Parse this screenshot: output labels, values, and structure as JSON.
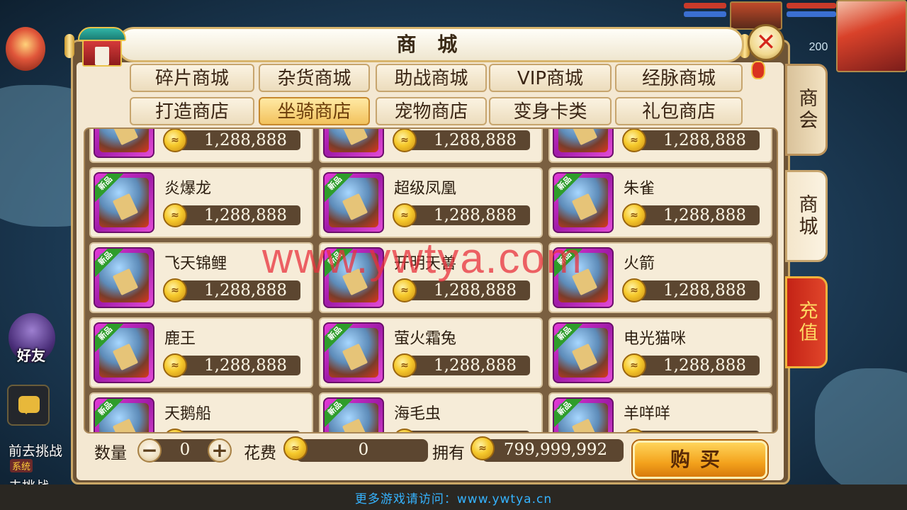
{
  "hud": {
    "hp_value": "200",
    "friend_label": "好友",
    "task_line1": "前去挑战",
    "task_tag": "系统",
    "task_line2": "去挑战"
  },
  "shop": {
    "title": "商 城",
    "close_glyph": "✕",
    "tabs_row1": [
      "碎片商城",
      "杂货商城",
      "助战商城",
      "VIP商城",
      "经脉商城"
    ],
    "tabs_row2": [
      "打造商店",
      "坐骑商店",
      "宠物商店",
      "变身卡类",
      "礼包商店"
    ],
    "active_tab": "坐骑商店",
    "new_tag": "新品",
    "coin_glyph": "≈",
    "items": [
      {
        "name": "",
        "price": "1,288,888"
      },
      {
        "name": "",
        "price": "1,288,888"
      },
      {
        "name": "",
        "price": "1,288,888"
      },
      {
        "name": "炎爆龙",
        "price": "1,288,888"
      },
      {
        "name": "超级凤凰",
        "price": "1,288,888"
      },
      {
        "name": "朱雀",
        "price": "1,288,888"
      },
      {
        "name": "飞天锦鲤",
        "price": "1,288,888"
      },
      {
        "name": "开明天兽",
        "price": "1,288,888"
      },
      {
        "name": "火箭",
        "price": "1,288,888"
      },
      {
        "name": "鹿王",
        "price": "1,288,888"
      },
      {
        "name": "萤火霜兔",
        "price": "1,288,888"
      },
      {
        "name": "电光猫咪",
        "price": "1,288,888"
      },
      {
        "name": "天鹅船",
        "price": ""
      },
      {
        "name": "海毛虫",
        "price": ""
      },
      {
        "name": "羊咩咩",
        "price": ""
      }
    ],
    "quantity_label": "数量",
    "quantity_value": "0",
    "minus_glyph": "−",
    "plus_glyph": "+",
    "cost_label": "花费",
    "cost_value": "0",
    "own_label": "拥有",
    "own_value": "799,999,992",
    "buy_label": "购买"
  },
  "side_tabs": [
    "商会",
    "商城",
    "充值"
  ],
  "watermark": "www.ywtya.com",
  "footer_text": "更多游戏请访问：www.ywtya.cn",
  "colors": {
    "panel_bg": "#f4e8d2",
    "item_frame": "#c02bbd",
    "new_tag": "#2e9d2a",
    "buy_button": "#f3a21c",
    "recharge_tab": "#c42316",
    "footer_link": "#35b3ff"
  }
}
